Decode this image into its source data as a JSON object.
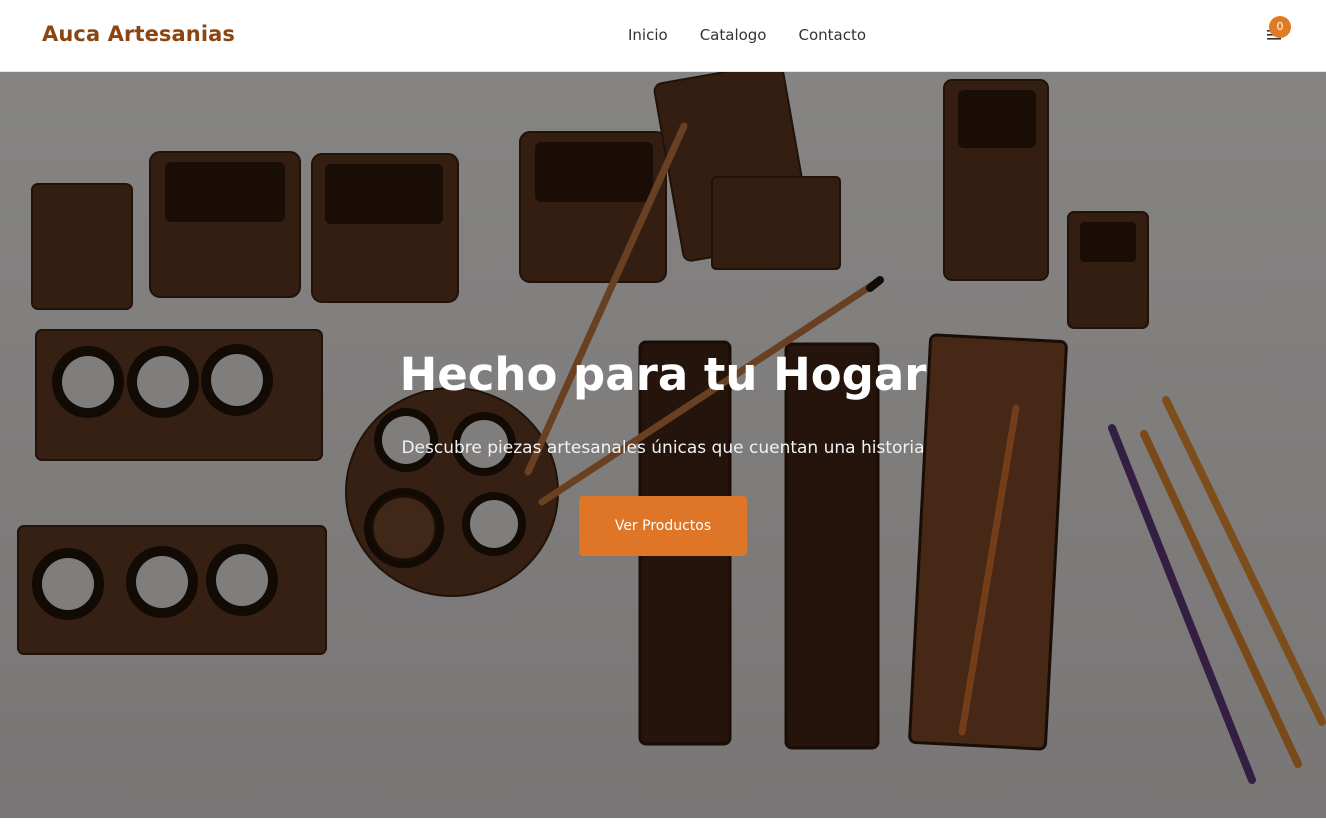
{
  "header": {
    "brand": "Auca Artesanias",
    "nav": [
      "Inicio",
      "Catalogo",
      "Contacto"
    ],
    "cart_count": "0",
    "cart_icon": "cart-list-icon"
  },
  "hero": {
    "title": "Hecho para tu Hogar",
    "subtitle": "Descubre piezas artesanales únicas que cuentan una historia",
    "cta_label": "Ver Productos",
    "background_image": "handcrafted wooden incense holders and candle holders on white fabric"
  },
  "colors": {
    "brand": "#8a4512",
    "accent": "#df7526",
    "badge": "#e07a24",
    "wood": "#6b3f22",
    "overlay": "rgba(0,0,0,0.42)"
  }
}
